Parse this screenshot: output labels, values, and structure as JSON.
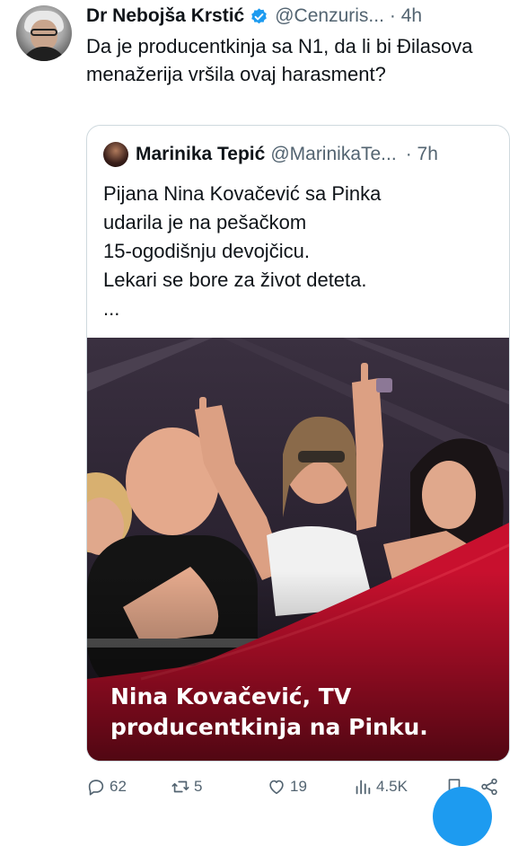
{
  "tweet": {
    "author_name": "Dr Nebojša Krstić",
    "author_handle": "@Cenzuris...",
    "time": "· 4h",
    "text": "Da je producentkinja sa N1, da li bi Đilasova menažerija vršila ovaj harasment?"
  },
  "quote": {
    "author_name": "Marinika Tepić",
    "author_handle": "@MarinikaTe...",
    "time": "· 7h",
    "text": "Pijana Nina Kovačević sa Pinka\nudarila je na pešačkom\n15-ogodišnju devojčicu.\nLekari se bore za život deteta.\n...",
    "image_caption_line1": "Nina Kovačević, TV",
    "image_caption_line2": "producentkinja na Pinku."
  },
  "actions": {
    "replies": "62",
    "reposts": "5",
    "likes": "19",
    "views": "4.5K"
  },
  "colors": {
    "verified_badge": "#1d9bf0",
    "secondary_text": "#536471",
    "banner_red": "#c8102e",
    "fab": "#1d9bf0"
  },
  "icons": {
    "reply": "reply-icon",
    "repost": "repost-icon",
    "like": "heart-icon",
    "views": "views-icon",
    "bookmark": "bookmark-icon",
    "share": "share-icon"
  }
}
